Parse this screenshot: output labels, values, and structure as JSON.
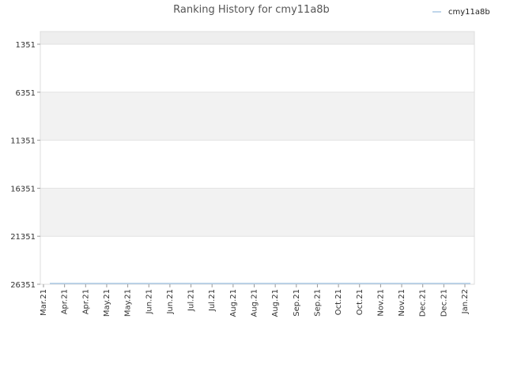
{
  "chart_data": {
    "type": "line",
    "title": "Ranking History for cmy11a8b",
    "xlabel": "",
    "ylabel": "",
    "y_inverted": true,
    "ylim": [
      26351,
      1351
    ],
    "yticks": [
      1351,
      6351,
      11351,
      16351,
      21351,
      26351
    ],
    "ytick_labels": [
      "1351",
      "6351",
      "11351",
      "16351",
      "21351",
      "26351"
    ],
    "categories": [
      "Mar.21",
      "Apr.21",
      "Apr.21",
      "May.21",
      "May.21",
      "Jun.21",
      "Jun.21",
      "Jul.21",
      "Jul.21",
      "Aug.21",
      "Aug.21",
      "Aug.21",
      "Sep.21",
      "Sep.21",
      "Oct.21",
      "Oct.21",
      "Nov.21",
      "Nov.21",
      "Dec.21",
      "Dec.21",
      "Jan.22"
    ],
    "series": [
      {
        "name": "cmy11a8b",
        "color": "#aac8e4",
        "values": [
          26351,
          26351,
          26351,
          26351,
          26351,
          26351,
          26351,
          26351,
          26351,
          26351,
          26351,
          26351,
          26351,
          26351,
          26351,
          26351,
          26351,
          26351,
          26351,
          26351,
          26351
        ]
      }
    ],
    "legend_position": "top-right",
    "grid": true,
    "band_colors": [
      "#f2f2f2",
      "#ffffff"
    ]
  }
}
